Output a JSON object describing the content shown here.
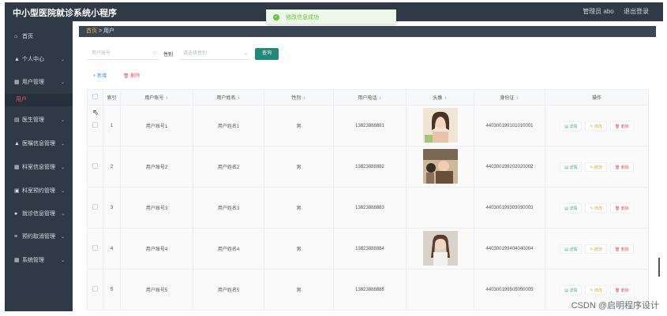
{
  "app": {
    "title": "中小型医院就诊系统小程序"
  },
  "topbar": {
    "user": "管理员 abo",
    "logout": "退出登录"
  },
  "toast": {
    "message": "修改信息成功"
  },
  "sidebar": {
    "items": [
      {
        "label": "首页",
        "icon": "home-icon",
        "glyph": "⌂"
      },
      {
        "label": "个人中心",
        "icon": "user-icon",
        "glyph": "▲"
      },
      {
        "label": "用户管理",
        "icon": "grid-icon",
        "glyph": "▦"
      },
      {
        "label": "医生管理",
        "icon": "folder-icon",
        "glyph": "▤"
      },
      {
        "label": "医嘱信息管理",
        "icon": "person-icon",
        "glyph": "▲"
      },
      {
        "label": "科室信息管理",
        "icon": "grid-icon",
        "glyph": "▦"
      },
      {
        "label": "科室预约管理",
        "icon": "calendar-icon",
        "glyph": "▣"
      },
      {
        "label": "就诊信息管理",
        "icon": "location-icon",
        "glyph": "●"
      },
      {
        "label": "预约取消管理",
        "icon": "list-icon",
        "glyph": "≡"
      },
      {
        "label": "系统管理",
        "icon": "grid-icon",
        "glyph": "▦"
      }
    ],
    "sub_active": "用户"
  },
  "breadcrumb": {
    "home": "首页",
    "sep": ">",
    "current": "用户"
  },
  "search": {
    "account_placeholder": "用户账号",
    "gender_label": "性别",
    "gender_placeholder": "请选择性别",
    "query_label": "查询"
  },
  "actions": {
    "add": "+ 新增",
    "delete": "🗑 删除"
  },
  "table": {
    "headers": [
      "索引",
      "用户账号",
      "用户姓名",
      "性别",
      "用户电话",
      "头像",
      "身份证",
      "操作"
    ],
    "rows": [
      {
        "index": "1",
        "account": "用户账号1",
        "name": "用户姓名1",
        "gender": "男",
        "phone": "13823888881",
        "has_avatar": true,
        "id_card": "440300199101010001"
      },
      {
        "index": "2",
        "account": "用户账号2",
        "name": "用户姓名2",
        "gender": "男",
        "phone": "13823888882",
        "has_avatar": true,
        "id_card": "440300199202020002"
      },
      {
        "index": "3",
        "account": "用户账号3",
        "name": "用户姓名3",
        "gender": "男",
        "phone": "13823888883",
        "has_avatar": false,
        "id_card": "440300199303030003"
      },
      {
        "index": "4",
        "account": "用户账号4",
        "name": "用户姓名4",
        "gender": "男",
        "phone": "13823888884",
        "has_avatar": true,
        "id_card": "440300199404040004"
      },
      {
        "index": "5",
        "account": "用户账号5",
        "name": "用户姓名5",
        "gender": "男",
        "phone": "13823888885",
        "has_avatar": false,
        "id_card": "440300199505050005"
      }
    ],
    "op_labels": {
      "detail": "详情",
      "edit": "修改",
      "remove": "删除"
    }
  },
  "watermark": "CSDN @启明程序设计",
  "colors": {
    "sidebar_bg": "#2f3a46",
    "accent": "#1f8a7a",
    "danger": "#e05a5a",
    "success": "#67c23a"
  }
}
